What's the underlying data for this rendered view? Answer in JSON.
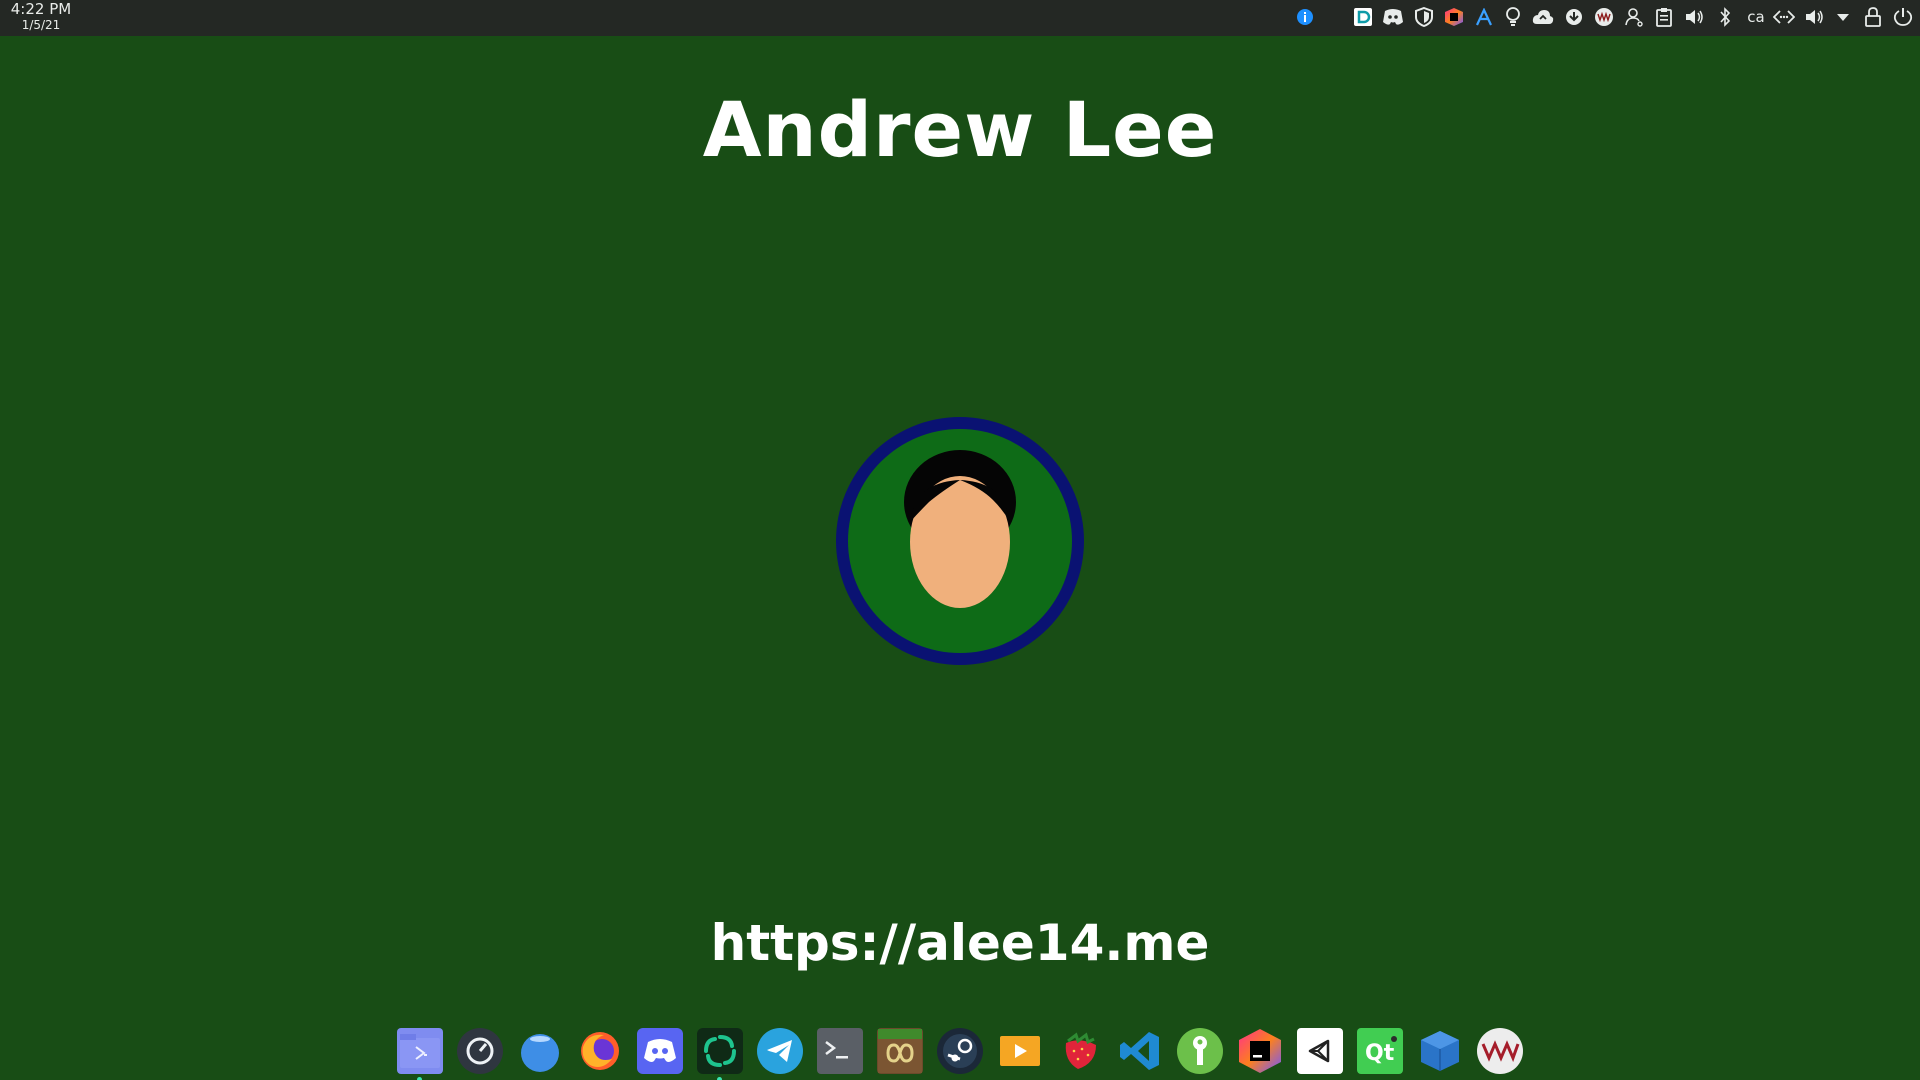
{
  "top_panel": {
    "clock": {
      "time": "4:22 PM",
      "date": "1/5/21"
    },
    "tray": {
      "icons": [
        "info-icon",
        "dashlane-icon",
        "discord-tray-icon",
        "shield-icon",
        "jetbrains-toolbox-icon",
        "font-a-icon",
        "lightbulb-icon",
        "cloud-sync-icon",
        "download-icon",
        "vm-tray-icon",
        "user-icon",
        "clipboard-icon",
        "volume-icon",
        "bluetooth-icon",
        "keyboard-layout-icon",
        "network-icon",
        "volume-output-icon",
        "chevron-down-icon",
        "lock-icon",
        "power-icon"
      ],
      "keyboard_layout": "ca"
    }
  },
  "desktop": {
    "title": "Andrew Lee",
    "url": "https://alee14.me",
    "colors": {
      "background": "#184d15",
      "avatar_ring": "#0a1272",
      "avatar_inner": "#0e6b17",
      "skin": "#f0b07c",
      "hair": "#050505"
    }
  },
  "dock": {
    "apps": [
      "file-manager-icon",
      "system-monitor-icon",
      "web-browser-icon",
      "firefox-icon",
      "discord-icon",
      "element-icon",
      "telegram-icon",
      "terminal-icon",
      "multimc-icon",
      "steam-icon",
      "media-player-icon",
      "strawberry-icon",
      "vscode-icon",
      "keepassxc-icon",
      "jetbrains-toolbox-icon",
      "unity-hub-icon",
      "qt-creator-icon",
      "virtualbox-icon",
      "vmware-icon"
    ]
  }
}
